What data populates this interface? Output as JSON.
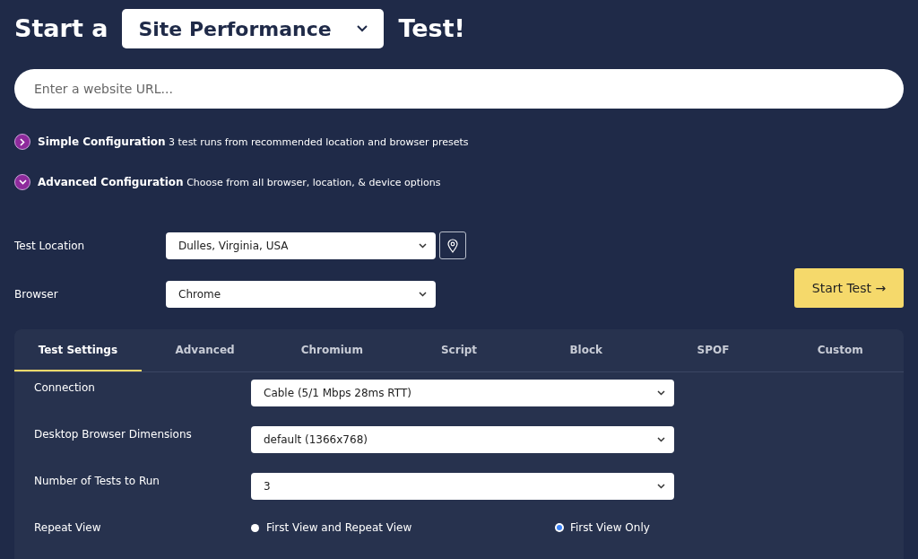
{
  "heading": {
    "prefix": "Start a",
    "test_type": "Site Performance",
    "suffix": "Test!"
  },
  "url_field": {
    "placeholder": "Enter a website URL..."
  },
  "configurations": [
    {
      "title": "Simple Configuration",
      "description": "3 test runs from recommended location and browser presets",
      "expanded": false
    },
    {
      "title": "Advanced Configuration",
      "description": "Choose from all browser, location, & device options",
      "expanded": true
    }
  ],
  "test_location": {
    "label": "Test Location",
    "value": "Dulles, Virginia, USA"
  },
  "browser": {
    "label": "Browser",
    "value": "Chrome"
  },
  "start_button": "Start Test →",
  "tabs": [
    {
      "label": "Test Settings",
      "selected": true
    },
    {
      "label": "Advanced",
      "selected": false
    },
    {
      "label": "Chromium",
      "selected": false
    },
    {
      "label": "Script",
      "selected": false
    },
    {
      "label": "Block",
      "selected": false
    },
    {
      "label": "SPOF",
      "selected": false
    },
    {
      "label": "Custom",
      "selected": false
    }
  ],
  "settings": [
    {
      "kind": "select",
      "label": "Connection",
      "value": "Cable (5/1 Mbps 28ms RTT)"
    },
    {
      "kind": "select",
      "label": "Desktop Browser Dimensions",
      "value": "default (1366x768)"
    },
    {
      "kind": "select",
      "label": "Number of Tests to Run",
      "value": "3"
    },
    {
      "kind": "radio",
      "label": "Repeat View",
      "options": [
        {
          "label": "First View and Repeat View",
          "selected": false
        },
        {
          "label": "First View Only",
          "selected": true
        }
      ]
    }
  ]
}
